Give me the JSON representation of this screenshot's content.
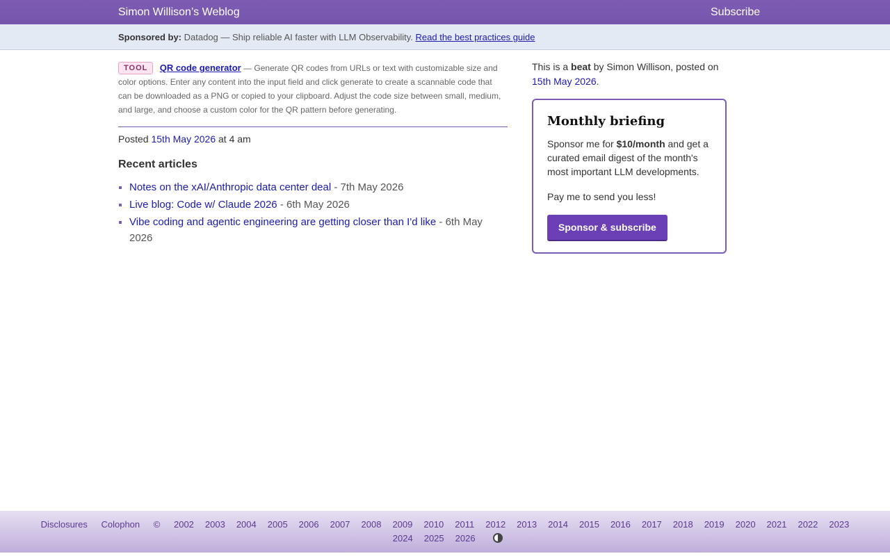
{
  "header": {
    "site_title": "Simon Willison’s Weblog",
    "subscribe_label": "Subscribe"
  },
  "sponsor_bar": {
    "label": "Sponsored by:",
    "text": "Datadog — Ship reliable AI faster with LLM Observability.",
    "link_text": "Read the best practices guide"
  },
  "entry": {
    "badge": "TOOL",
    "title": "QR code generator",
    "description": "— Generate QR codes from URLs or text with customizable size and color options. Enter any content into the input field and click generate to create a scannable code that can be downloaded as a PNG or copied to your clipboard. Adjust the code size between small, medium, and large, and choose a custom color for the QR pattern before generating.",
    "posted_prefix": "Posted",
    "posted_date": "15th May 2026",
    "posted_time": "at 4 am"
  },
  "recent": {
    "heading": "Recent articles",
    "items": [
      {
        "title": "Notes on the xAI/Anthropic data center deal",
        "date": "- 7th May 2026"
      },
      {
        "title": "Live blog: Code w/ Claude 2026",
        "date": "- 6th May 2026"
      },
      {
        "title": "Vibe coding and agentic engineering are getting closer than I'd like",
        "date": "- 6th May 2026"
      }
    ]
  },
  "sidebar": {
    "beat_prefix": "This is a",
    "beat_word": "beat",
    "beat_suffix": "by Simon Willison, posted on",
    "beat_date": "15th May 2026",
    "beat_end": ".",
    "card_title": "Monthly briefing",
    "card_text_prefix": "Sponsor me for",
    "card_price": "$10/month",
    "card_text_suffix": "and get a curated email digest of the month's most important LLM developments.",
    "card_text_2": "Pay me to send you less!",
    "button_label": "Sponsor & subscribe"
  },
  "footer": {
    "disclosures": "Disclosures",
    "colophon": "Colophon",
    "copyright": "©",
    "years_row1": [
      "2002",
      "2003",
      "2004",
      "2005",
      "2006",
      "2007",
      "2008",
      "2009",
      "2010",
      "2011",
      "2012",
      "2013",
      "2014",
      "2015",
      "2016",
      "2017",
      "2018",
      "2019",
      "2020",
      "2021",
      "2022",
      "2023"
    ],
    "years_row2": [
      "2024",
      "2025",
      "2026"
    ]
  },
  "colors": {
    "accent": "#7d5bb4",
    "link": "#1b1bb0",
    "button": "#6b3fb6"
  }
}
